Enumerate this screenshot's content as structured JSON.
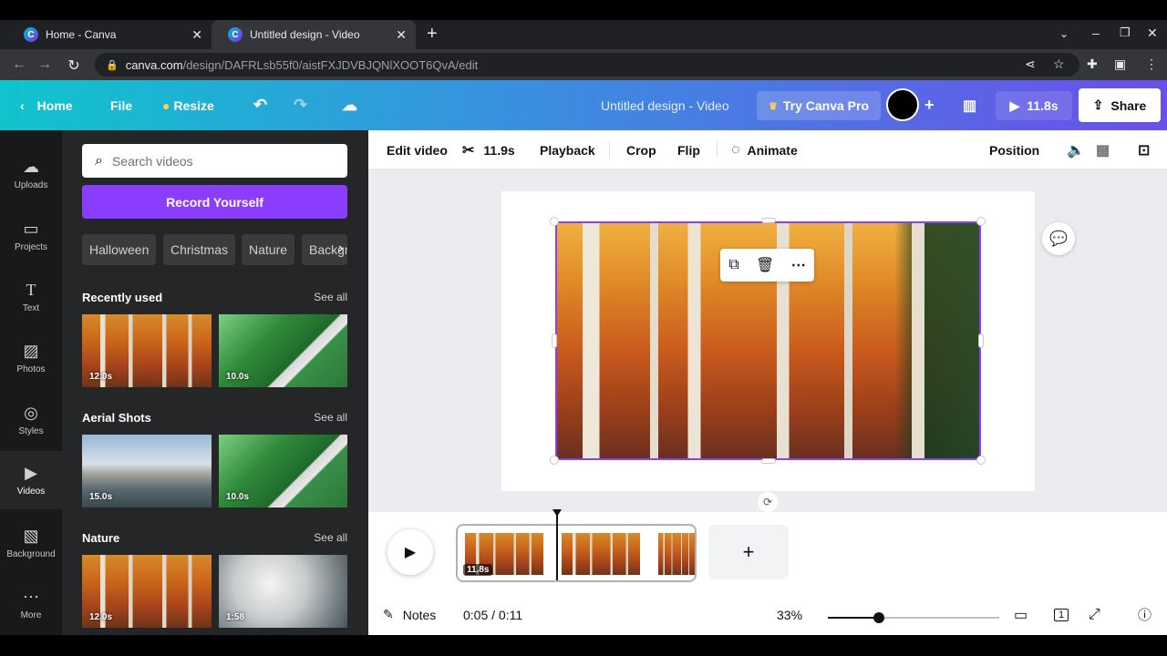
{
  "browser": {
    "tabs": [
      {
        "title": "Home - Canva",
        "close": "✕"
      },
      {
        "title": "Untitled design - Video",
        "close": "✕"
      }
    ],
    "new_tab": "+",
    "url_host": "canva.com",
    "url_path": "/design/DAFRLsb55f0/aistFXJDVBJQNlXOOT6QvA/edit"
  },
  "header": {
    "home": "Home",
    "file": "File",
    "resize": "Resize",
    "title": "Untitled design - Video",
    "try_pro": "Try Canva Pro",
    "add": "+",
    "duration": "11.8s",
    "share": "Share"
  },
  "rail": [
    {
      "label": "Uploads",
      "icon": "upload-icon"
    },
    {
      "label": "Projects",
      "icon": "folder-icon"
    },
    {
      "label": "Text",
      "icon": "text-icon"
    },
    {
      "label": "Photos",
      "icon": "photo-icon"
    },
    {
      "label": "Styles",
      "icon": "palette-icon"
    },
    {
      "label": "Videos",
      "icon": "video-icon"
    },
    {
      "label": "Background",
      "icon": "background-icon"
    },
    {
      "label": "More",
      "icon": "more-icon"
    }
  ],
  "panel": {
    "search_placeholder": "Search videos",
    "record": "Record Yourself",
    "chips": [
      "Halloween",
      "Christmas",
      "Nature",
      "Backgr"
    ],
    "sections": [
      {
        "title": "Recently used",
        "see_all": "See all",
        "items": [
          "12.0s",
          "10.0s"
        ]
      },
      {
        "title": "Aerial Shots",
        "see_all": "See all",
        "items": [
          "15.0s",
          "10.0s"
        ]
      },
      {
        "title": "Nature",
        "see_all": "See all",
        "items": [
          "12.0s",
          "1:58"
        ]
      }
    ]
  },
  "toolbar": {
    "edit_video": "Edit video",
    "trim": "11.9s",
    "playback": "Playback",
    "crop": "Crop",
    "flip": "Flip",
    "animate": "Animate",
    "position": "Position"
  },
  "timeline": {
    "clip_duration": "11.8s",
    "add": "+"
  },
  "footer": {
    "notes": "Notes",
    "time": "0:05 / 0:11",
    "zoom": "33%",
    "page_count": "1"
  },
  "colors": {
    "accent": "#8b3dff",
    "header_start": "#10c4cc",
    "header_end": "#6b4fe8"
  }
}
